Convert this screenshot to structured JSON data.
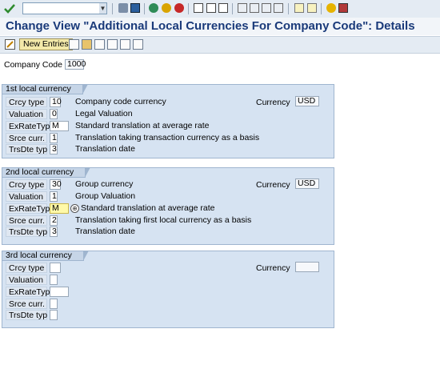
{
  "window": {
    "title": "Change View \"Additional Local Currencies For Company Code\": Details"
  },
  "toolbar": {
    "command_value": "",
    "new_entries_label": "New Entries",
    "icons": [
      "check-icon",
      "back-icon",
      "exit-icon",
      "cancel-icon",
      "print-icon",
      "find-icon",
      "find-next-icon",
      "first-page-icon",
      "prev-page-icon",
      "next-page-icon",
      "last-page-icon",
      "create-session-icon",
      "shortcut-icon",
      "help-icon",
      "layout-icon"
    ]
  },
  "form": {
    "company_code_label": "Company Code",
    "company_code_value": "1000"
  },
  "groups": [
    {
      "title": "1st local currency",
      "currency_label": "Currency",
      "currency_value": "USD",
      "rows": [
        {
          "label": "Crcy type",
          "value": "10",
          "desc": "Company code currency"
        },
        {
          "label": "Valuation",
          "value": "0",
          "desc": "Legal Valuation"
        },
        {
          "label": "ExRateType",
          "value": "M",
          "desc": "Standard translation at average rate"
        },
        {
          "label": "Srce curr.",
          "value": "1",
          "desc": "Translation taking transaction currency as a basis"
        },
        {
          "label": "TrsDte typ",
          "value": "3",
          "desc": "Translation date"
        }
      ]
    },
    {
      "title": "2nd local currency",
      "currency_label": "Currency",
      "currency_value": "USD",
      "rows": [
        {
          "label": "Crcy type",
          "value": "30",
          "desc": "Group currency"
        },
        {
          "label": "Valuation",
          "value": "1",
          "desc": "Group Valuation"
        },
        {
          "label": "ExRateType",
          "value": "M",
          "desc": "Standard translation at average rate"
        },
        {
          "label": "Srce curr.",
          "value": "2",
          "desc": "Translation taking first local currency as a basis"
        },
        {
          "label": "TrsDte typ",
          "value": "3",
          "desc": "Translation date"
        }
      ]
    },
    {
      "title": "3rd local currency",
      "currency_label": "Currency",
      "currency_value": "",
      "rows": [
        {
          "label": "Crcy type",
          "value": "",
          "desc": ""
        },
        {
          "label": "Valuation",
          "value": "",
          "desc": ""
        },
        {
          "label": "ExRateType",
          "value": "",
          "desc": ""
        },
        {
          "label": "Srce curr.",
          "value": "",
          "desc": ""
        },
        {
          "label": "TrsDte typ",
          "value": "",
          "desc": ""
        }
      ]
    }
  ]
}
